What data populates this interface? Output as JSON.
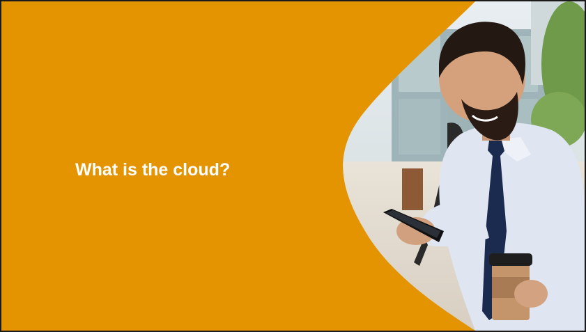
{
  "slide": {
    "title": "What is the cloud?",
    "background_color": "#e39400",
    "title_color": "#ffffff"
  },
  "photo": {
    "subject": "smiling bearded man in white shirt and navy tie looking at smartphone, holding takeaway coffee cup, backpack strap on shoulder, outdoors near glass building"
  }
}
